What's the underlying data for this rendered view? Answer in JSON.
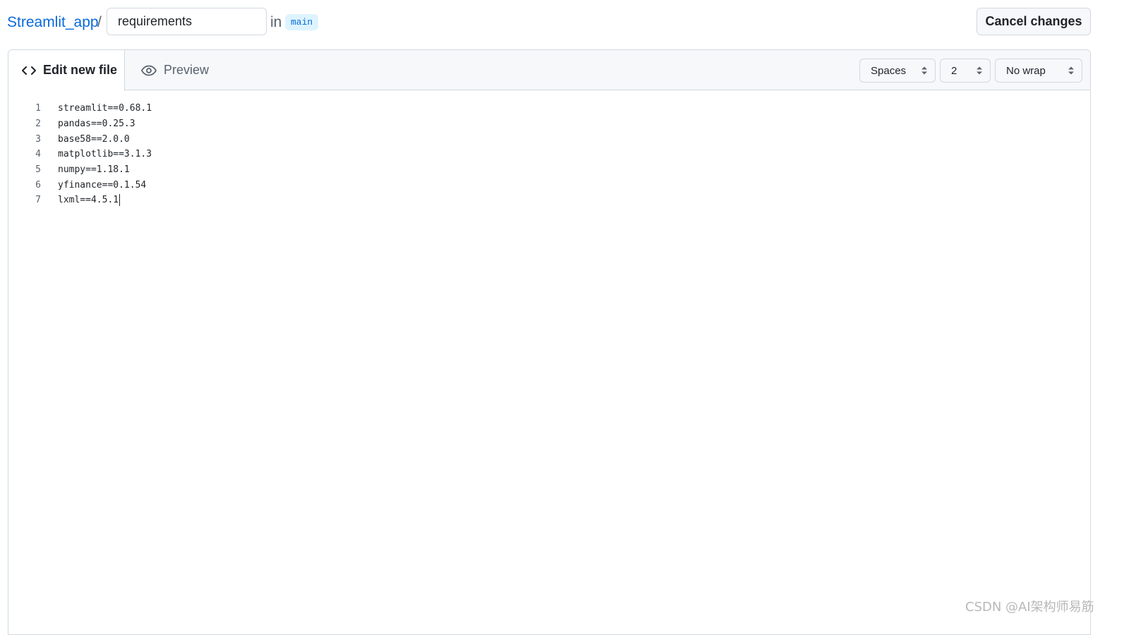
{
  "header": {
    "repo_name": "Streamlit_app",
    "separator": "/",
    "filename_value": "requirements",
    "in_label": "in",
    "branch": "main",
    "cancel_label": "Cancel changes"
  },
  "editor": {
    "tabs": [
      {
        "label": "Edit new file",
        "icon": "code-icon",
        "active": true
      },
      {
        "label": "Preview",
        "icon": "eye-icon",
        "active": false
      }
    ],
    "indent_mode": "Spaces",
    "indent_size": "2",
    "wrap_mode": "No wrap",
    "lines": [
      {
        "num": "1",
        "text": "streamlit==0.68.1"
      },
      {
        "num": "2",
        "text": "pandas==0.25.3"
      },
      {
        "num": "3",
        "text": "base58==2.0.0"
      },
      {
        "num": "4",
        "text": "matplotlib==3.1.3"
      },
      {
        "num": "5",
        "text": "numpy==1.18.1"
      },
      {
        "num": "6",
        "text": "yfinance==0.1.54"
      },
      {
        "num": "7",
        "text": "lxml==4.5.1"
      }
    ]
  },
  "watermark": "CSDN @AI架构师易筋",
  "colors": {
    "link": "#0969da",
    "branch_bg": "#ddf4ff",
    "header_bg": "#f6f8fa",
    "border": "#d1d9e0"
  }
}
